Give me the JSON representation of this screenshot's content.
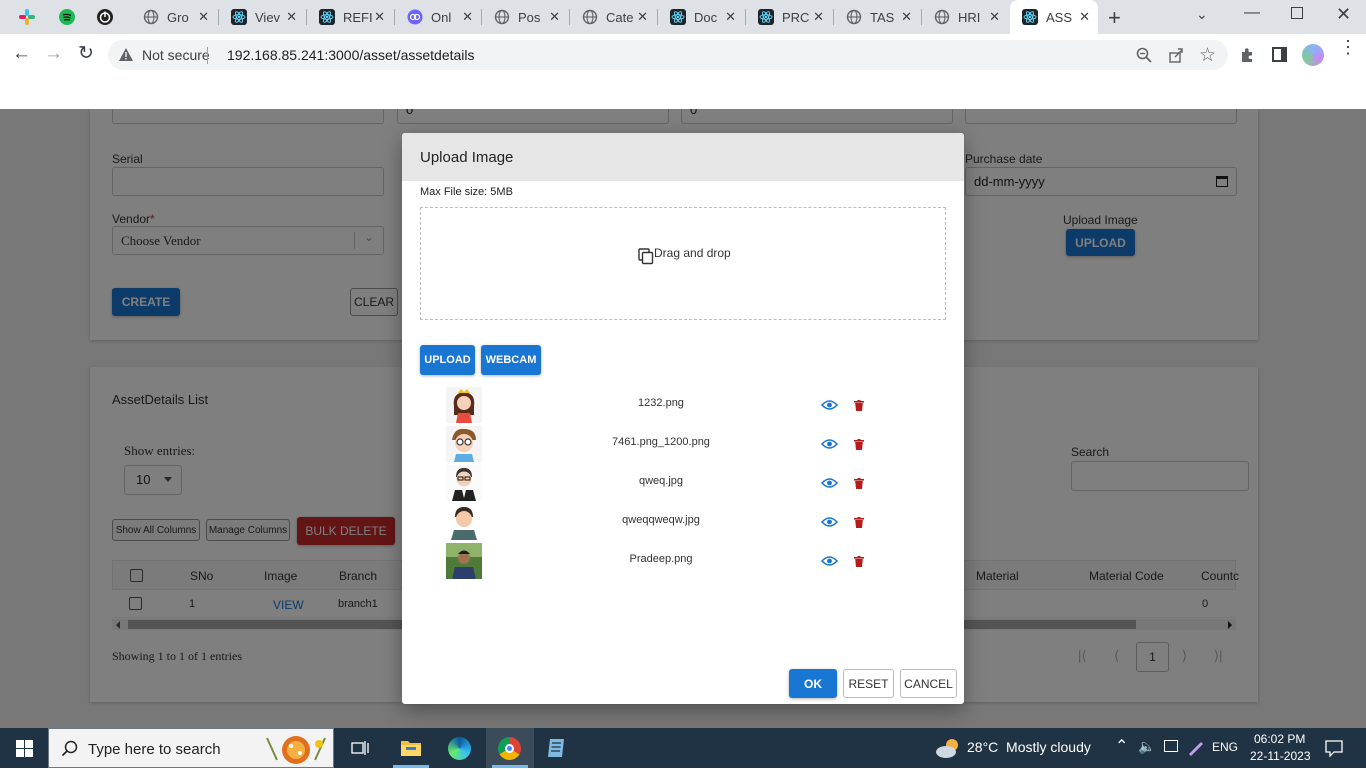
{
  "browser": {
    "tabs": [
      {
        "label": "Gro",
        "icon": "globe-icon"
      },
      {
        "label": "Viev",
        "icon": "react-icon"
      },
      {
        "label": "REFI",
        "icon": "react-icon"
      },
      {
        "label": "Onl",
        "icon": "link-icon"
      },
      {
        "label": "Pos",
        "icon": "globe-icon"
      },
      {
        "label": "Cate",
        "icon": "globe-icon"
      },
      {
        "label": "Doc",
        "icon": "react-icon"
      },
      {
        "label": "PRC",
        "icon": "react-icon"
      },
      {
        "label": "TAS",
        "icon": "globe-icon"
      },
      {
        "label": "HRI",
        "icon": "globe-icon"
      },
      {
        "label": "ASS",
        "icon": "react-icon"
      }
    ],
    "security": "Not secure",
    "url": "192.168.85.241:3000/asset/assetdetails"
  },
  "form": {
    "top_values": [
      "0",
      "0"
    ],
    "serial_label": "Serial",
    "purchase_date_label": "Purchase date",
    "purchase_date_placeholder": "dd-mm-yyyy",
    "vendor_label": "Vendor",
    "vendor_required": "*",
    "vendor_placeholder": "Choose Vendor",
    "upload_image_label": "Upload Image",
    "upload_button": "UPLOAD",
    "create_button": "CREATE",
    "clear_button": "CLEAR"
  },
  "list": {
    "title": "AssetDetails List",
    "show_entries_label": "Show entries:",
    "entries_value": "10",
    "show_all_columns": "Show All Columns",
    "manage_columns": "Manage Columns",
    "bulk_delete": "BULK DELETE",
    "search_label": "Search",
    "columns": [
      "SNo",
      "Image",
      "Branch",
      "Material",
      "Material Code",
      "Countc"
    ],
    "row": {
      "sno": "1",
      "image": "VIEW",
      "branch": "branch1",
      "count": "0"
    },
    "footer": "Showing 1 to 1 of 1 entries",
    "page": "1"
  },
  "modal": {
    "title": "Upload Image",
    "max_size": "Max File size: 5MB",
    "drop_text": "Drag and drop",
    "upload_button": "UPLOAD",
    "webcam_button": "WEBCAM",
    "files": [
      {
        "name": "1232.png",
        "avatar": "girl-avatar"
      },
      {
        "name": "7461.png_1200.png",
        "avatar": "glasses-boy-avatar"
      },
      {
        "name": "qweq.jpg",
        "avatar": "businessman-avatar"
      },
      {
        "name": "qweqqweqw.jpg",
        "avatar": "young-man-avatar"
      },
      {
        "name": "Pradeep.png",
        "avatar": "photo-avatar"
      }
    ],
    "ok_button": "OK",
    "reset_button": "RESET",
    "cancel_button": "CANCEL"
  },
  "taskbar": {
    "search_placeholder": "Type here to search",
    "weather": "28°C  Mostly cloudy",
    "language": "ENG",
    "time": "06:02 PM",
    "date": "22-11-2023"
  },
  "colors": {
    "primary": "#1976d2",
    "danger": "#c62828",
    "delete_icon": "#b71c1c",
    "taskbar": "#1f3345"
  }
}
